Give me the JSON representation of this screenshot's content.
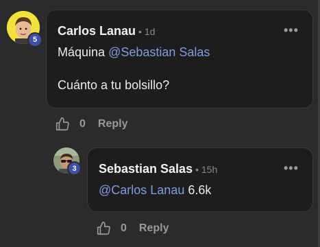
{
  "comments": [
    {
      "author": "Carlos Lanau",
      "time": "• 1d",
      "badge": "5",
      "line1_prefix": "Máquina ",
      "line1_mention": "@Sebastian Salas",
      "line2": "Cuánto a tu bolsillo?",
      "likes": "0",
      "reply_label": "Reply",
      "more_label": "•••"
    },
    {
      "author": "Sebastian Salas",
      "time": "• 15h",
      "badge": "3",
      "line1_mention": "@Carlos Lanau",
      "line1_suffix": " 6.6k",
      "likes": "0",
      "reply_label": "Reply",
      "more_label": "•••"
    }
  ],
  "colors": {
    "background": "#2b2b2b",
    "bubble": "#1d1d1d",
    "mention": "#7f9de0",
    "badge": "#3d4fa8",
    "avatar1_bg": "#f3e23a"
  },
  "icons": [
    "thumbs-up-icon",
    "more-options-icon"
  ]
}
